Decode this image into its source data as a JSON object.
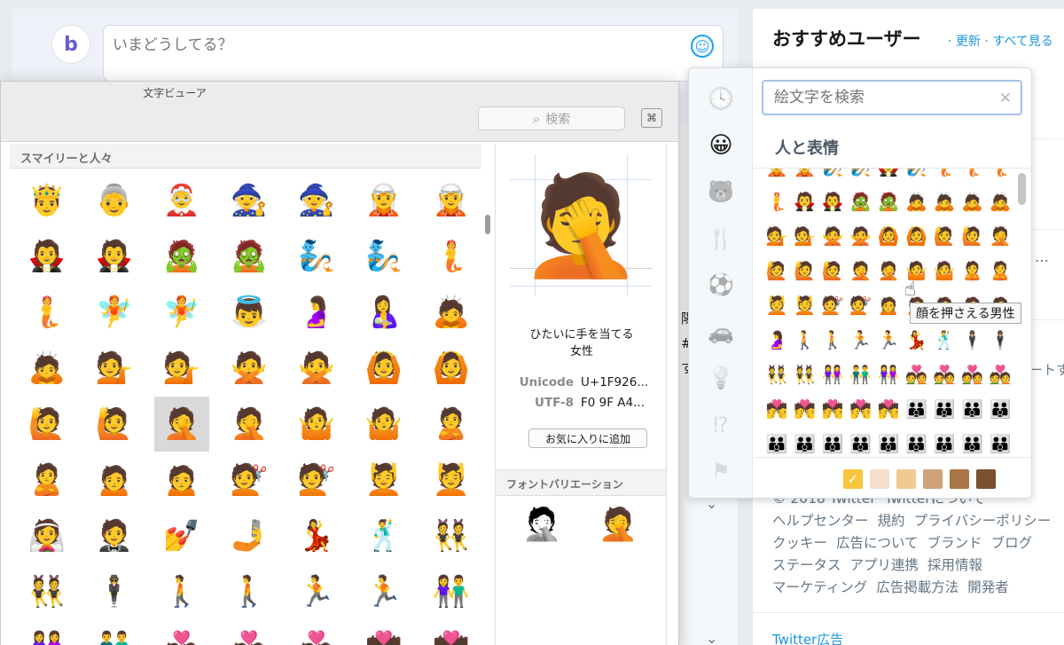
{
  "composer": {
    "avatar_letter": "b",
    "placeholder": "いまどうしてる？",
    "emoji_button": "☺"
  },
  "middle_fragments": [
    "陽",
    "#",
    "す"
  ],
  "right_panel": {
    "title": "おすすめユーザー",
    "sep1": "·",
    "refresh": "更新",
    "sep2": "·",
    "see_all": "すべて見る",
    "dots": "…",
    "fragment": "ートす",
    "footer_rows": [
      [
        "© 2018 Twitter",
        "Twitterについて"
      ],
      [
        "ヘルプセンター",
        "規約",
        "プライバシーポリシー"
      ],
      [
        "クッキー",
        "広告について",
        "ブランド",
        "ブログ"
      ],
      [
        "ステータス",
        "アプリ連携",
        "採用情報"
      ],
      [
        "マーケティング",
        "広告掲載方法",
        "開発者"
      ]
    ],
    "bottom_link": "Twitter広告"
  },
  "char_viewer": {
    "title": "文字ビューア",
    "search_placeholder": "検索",
    "search_icon": "⌕",
    "keyboard_icon": "⌘",
    "category": "スマイリーと人々",
    "grid": [
      [
        "🤴",
        "👵",
        "🤶",
        "🧙",
        "🧙",
        "🧝",
        "🧝"
      ],
      [
        "🧛",
        "🧛",
        "🧟",
        "🧟",
        "🧞",
        "🧞",
        "🧜"
      ],
      [
        "🧜",
        "🧚",
        "🧚",
        "👼",
        "🤰",
        "🤱",
        "🙇"
      ],
      [
        "🙇",
        "💁",
        "💁",
        "🙅",
        "🙅",
        "🙆",
        "🙆"
      ],
      [
        "🙋",
        "🙋",
        "🤦",
        "🤦",
        "🤷",
        "🤷",
        "🙎"
      ],
      [
        "🙎",
        "🙍",
        "🙍",
        "💇",
        "💇",
        "💆",
        "💆"
      ],
      [
        "👰",
        "🤵",
        "💅",
        "🤳",
        "💃",
        "🕺",
        "👯"
      ],
      [
        "👯",
        "🕴",
        "🚶",
        "🚶",
        "🏃",
        "🏃",
        "👫"
      ],
      [
        "👭",
        "👬",
        "💑",
        "💑",
        "💑",
        "💏",
        "💏"
      ]
    ],
    "selected": [
      4,
      2
    ],
    "preview_emoji": "🤦",
    "char_name_line1": "ひたいに手を当てる",
    "char_name_line2": "女性",
    "unicode_label": "Unicode",
    "unicode_value": "U+1F926...",
    "utf8_label": "UTF-8",
    "utf8_value": "F0 9F A4...",
    "favorite_button": "お気に入りに追加",
    "font_variation_title": "フォントバリエーション",
    "font_variations": [
      "🤦",
      "🤦"
    ]
  },
  "emoji_picker": {
    "nav_icons": [
      "🕓",
      "😀",
      "🐻",
      "🍴",
      "⚽",
      "🚗",
      "💡",
      "⁉",
      "⚑"
    ],
    "nav_active": 1,
    "search_placeholder": "絵文字を検索",
    "clear_icon": "✕",
    "category_title": "人と表情",
    "grid": [
      [
        "🧝",
        "🧝",
        "🧞",
        "🧞",
        "🧛",
        "🧞",
        "🧜",
        "🧜",
        "🧜"
      ],
      [
        "🧜",
        "🧛",
        "🧛",
        "🧟",
        "🧟",
        "🙇",
        "🙇",
        "🙇",
        "🙇"
      ],
      [
        "💁",
        "💁",
        "🙅",
        "🙅",
        "🙆",
        "🙆",
        "🙋",
        "🙋",
        "🤦"
      ],
      [
        "🙋",
        "🙋",
        "🙋",
        "🤦",
        "🤦",
        "🤷",
        "🤷",
        "🙎",
        "🙎"
      ],
      [
        "💆",
        "💆",
        "💇",
        "💇",
        "🙍",
        "🙍",
        "🙍",
        "🙍",
        "🙍"
      ],
      [
        "🤰",
        "🚶",
        "🚶",
        "🏃",
        "🏃",
        "💃",
        "🕺",
        "🕴",
        "🕴"
      ],
      [
        "👯",
        "👯",
        "👭",
        "👬",
        "👭",
        "💑",
        "💑",
        "💑",
        "💑"
      ],
      [
        "💏",
        "💏",
        "💏",
        "💏",
        "💏",
        "👪",
        "👪",
        "👪",
        "👪"
      ],
      [
        "👪",
        "👪",
        "👪",
        "👪",
        "👪",
        "👪",
        "👪",
        "👪",
        "👪"
      ]
    ],
    "tones": [
      "#f9c53d",
      "#f6decb",
      "#f0ca93",
      "#d1a27a",
      "#a97549",
      "#7b4f30"
    ],
    "tone_selected": 0,
    "tone_check": "✓",
    "tooltip": "顔を押さえる男性",
    "cursor_icon": "☝"
  }
}
